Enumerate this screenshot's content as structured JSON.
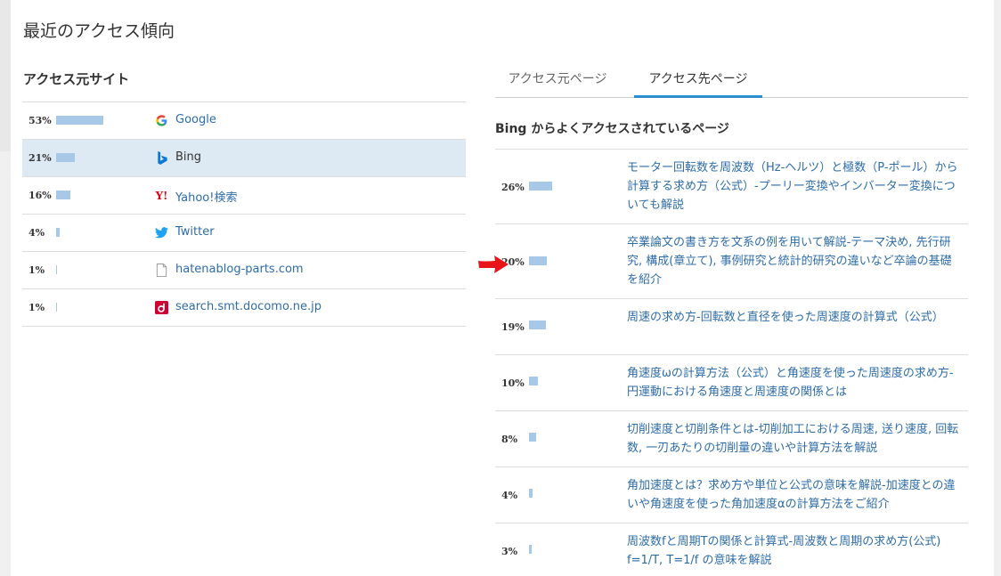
{
  "page_title": "最近のアクセス傾向",
  "sources": {
    "heading": "アクセス元サイト",
    "items": [
      {
        "pct": "53%",
        "value": 53,
        "name": "Google",
        "icon": "google-icon"
      },
      {
        "pct": "21%",
        "value": 21,
        "name": "Bing",
        "icon": "bing-icon",
        "selected": true
      },
      {
        "pct": "16%",
        "value": 16,
        "name": "Yahoo!検索",
        "icon": "yahoo-icon"
      },
      {
        "pct": "4%",
        "value": 4,
        "name": "Twitter",
        "icon": "twitter-icon"
      },
      {
        "pct": "1%",
        "value": 1,
        "name": "hatenablog-parts.com",
        "icon": "page-icon"
      },
      {
        "pct": "1%",
        "value": 1,
        "name": "search.smt.docomo.ne.jp",
        "icon": "docomo-icon"
      }
    ]
  },
  "tabs": [
    {
      "label": "アクセス元ページ",
      "active": false
    },
    {
      "label": "アクセス先ページ",
      "active": true
    }
  ],
  "destinations": {
    "heading": "Bing からよくアクセスされているページ",
    "items": [
      {
        "pct": "26%",
        "value": 26,
        "title": "モーター回転数を周波数（Hz-ヘルツ）と極数（P-ポール）から計算する求め方（公式）-プーリー変換やインバーター変換についても解説"
      },
      {
        "pct": "20%",
        "value": 20,
        "title": "卒業論文の書き方を文系の例を用いて解説-テーマ決め, 先行研究, 構成(章立て), 事例研究と統計的研究の違いなど卒論の基礎を紹介"
      },
      {
        "pct": "19%",
        "value": 19,
        "title": "周速の求め方-回転数と直径を使った周速度の計算式（公式）"
      },
      {
        "pct": "10%",
        "value": 10,
        "title": "角速度ωの計算方法（公式）と角速度を使った周速度の求め方-円運動における角速度と周速度の関係とは"
      },
      {
        "pct": "8%",
        "value": 8,
        "title": "切削速度と切削条件とは-切削加工における周速, 送り速度, 回転数, 一刃あたりの切削量の違いや計算方法を解説"
      },
      {
        "pct": "4%",
        "value": 4,
        "title": "角加速度とは？求め方や単位と公式の意味を解説-加速度との違いや角速度を使った角加速度αの計算方法をご紹介"
      },
      {
        "pct": "3%",
        "value": 3,
        "title": "周波数fと周期Tの関係と計算式-周波数と周期の求め方(公式) f=1/T, T=1/f の意味を解説"
      }
    ]
  },
  "colors": {
    "bar": "#a8c8e8",
    "link": "#2e6ca8",
    "tab_active": "#2e8fd0",
    "arrow": "#e8141a",
    "selected_row": "#deeaf3"
  }
}
